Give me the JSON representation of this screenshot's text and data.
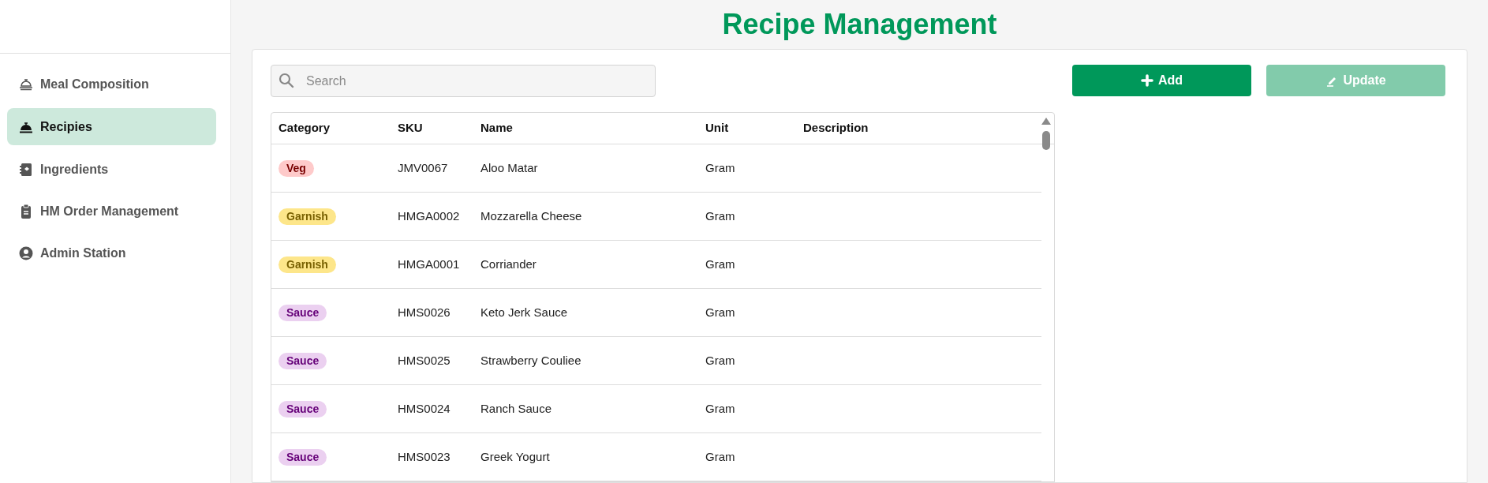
{
  "sidebar": {
    "items": [
      {
        "label": "Meal Composition",
        "selected": false
      },
      {
        "label": "Recipies",
        "selected": true
      },
      {
        "label": "Ingredients",
        "selected": false
      },
      {
        "label": "HM Order Management",
        "selected": false
      },
      {
        "label": "Admin Station",
        "selected": false
      }
    ]
  },
  "page_title": "Recipe Management",
  "search": {
    "placeholder": "Search"
  },
  "buttons": [
    {
      "label": "Add",
      "disabled": false
    },
    {
      "label": "Update",
      "disabled": true
    }
  ],
  "table": {
    "columns": [
      "Category",
      "SKU",
      "Name",
      "Unit",
      "Description"
    ],
    "rows": [
      {
        "category": {
          "label": "Veg",
          "color": "#fecaca"
        },
        "sku": "JMV0067",
        "name": "Aloo Matar",
        "unit": "Gram"
      },
      {
        "category": {
          "label": "Garnish",
          "color": "#fde68a"
        },
        "sku": "HMGA0002",
        "name": "Mozzarella Cheese",
        "unit": "Gram"
      },
      {
        "category": {
          "label": "Garnish",
          "color": "#fde68a"
        },
        "sku": "HMGA0001",
        "name": "Corriander",
        "unit": "Gram"
      },
      {
        "category": {
          "label": "Sauce",
          "color": "#ebd0f0"
        },
        "sku": "HMS0026",
        "name": "Keto Jerk Sauce",
        "unit": "Gram"
      },
      {
        "category": {
          "label": "Sauce",
          "color": "#ebd0f0"
        },
        "sku": "HMS0025",
        "name": "Strawberry Couliee",
        "unit": "Gram"
      },
      {
        "category": {
          "label": "Sauce",
          "color": "#ebd0f0"
        },
        "sku": "HMS0024",
        "name": "Ranch Sauce",
        "unit": "Gram"
      },
      {
        "category": {
          "label": "Sauce",
          "color": "#ebd0f0"
        },
        "sku": "HMS0023",
        "name": "Greek Yogurt",
        "unit": "Gram"
      }
    ]
  }
}
